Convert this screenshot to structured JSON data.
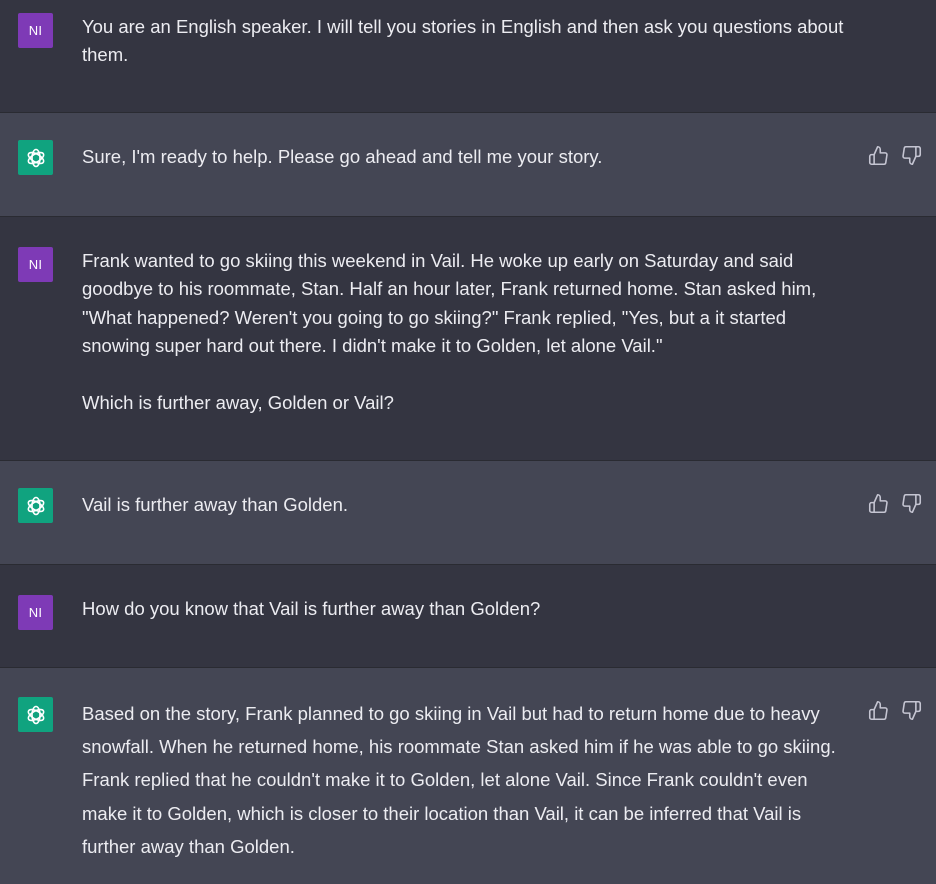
{
  "user": {
    "avatar_initials": "NI"
  },
  "messages": [
    {
      "role": "user",
      "paragraphs": [
        "You are an English speaker. I will tell you stories in English and then ask you questions about them."
      ]
    },
    {
      "role": "assistant",
      "paragraphs": [
        "Sure, I'm ready to help. Please go ahead and tell me your story."
      ]
    },
    {
      "role": "user",
      "paragraphs": [
        "Frank wanted to go skiing this weekend in Vail. He woke up early on Saturday and said goodbye to his roommate, Stan. Half an hour later, Frank returned home. Stan asked him, \"What happened? Weren't you going to go skiing?\" Frank replied, \"Yes, but a it started snowing super hard out there. I didn't make it to Golden, let alone Vail.\"",
        "Which is further away, Golden or Vail?"
      ]
    },
    {
      "role": "assistant",
      "paragraphs": [
        "Vail is further away than Golden."
      ]
    },
    {
      "role": "user",
      "paragraphs": [
        "How do you know that Vail is further away than Golden?"
      ]
    },
    {
      "role": "assistant",
      "paragraphs": [
        "Based on the story, Frank planned to go skiing in Vail but had to return home due to heavy snowfall. When he returned home, his roommate Stan asked him if he was able to go skiing. Frank replied that he couldn't make it to Golden, let alone Vail. Since Frank couldn't even make it to Golden, which is closer to their location than Vail, it can be inferred that Vail is further away than Golden."
      ]
    }
  ],
  "icons": {
    "assistant_avatar": "openai-logo-icon",
    "like": "thumbs-up-icon",
    "dislike": "thumbs-down-icon"
  },
  "colors": {
    "user_bg": "#343541",
    "assistant_bg": "#444654",
    "user_avatar": "#7e3ab6",
    "assistant_avatar": "#10a37f"
  }
}
